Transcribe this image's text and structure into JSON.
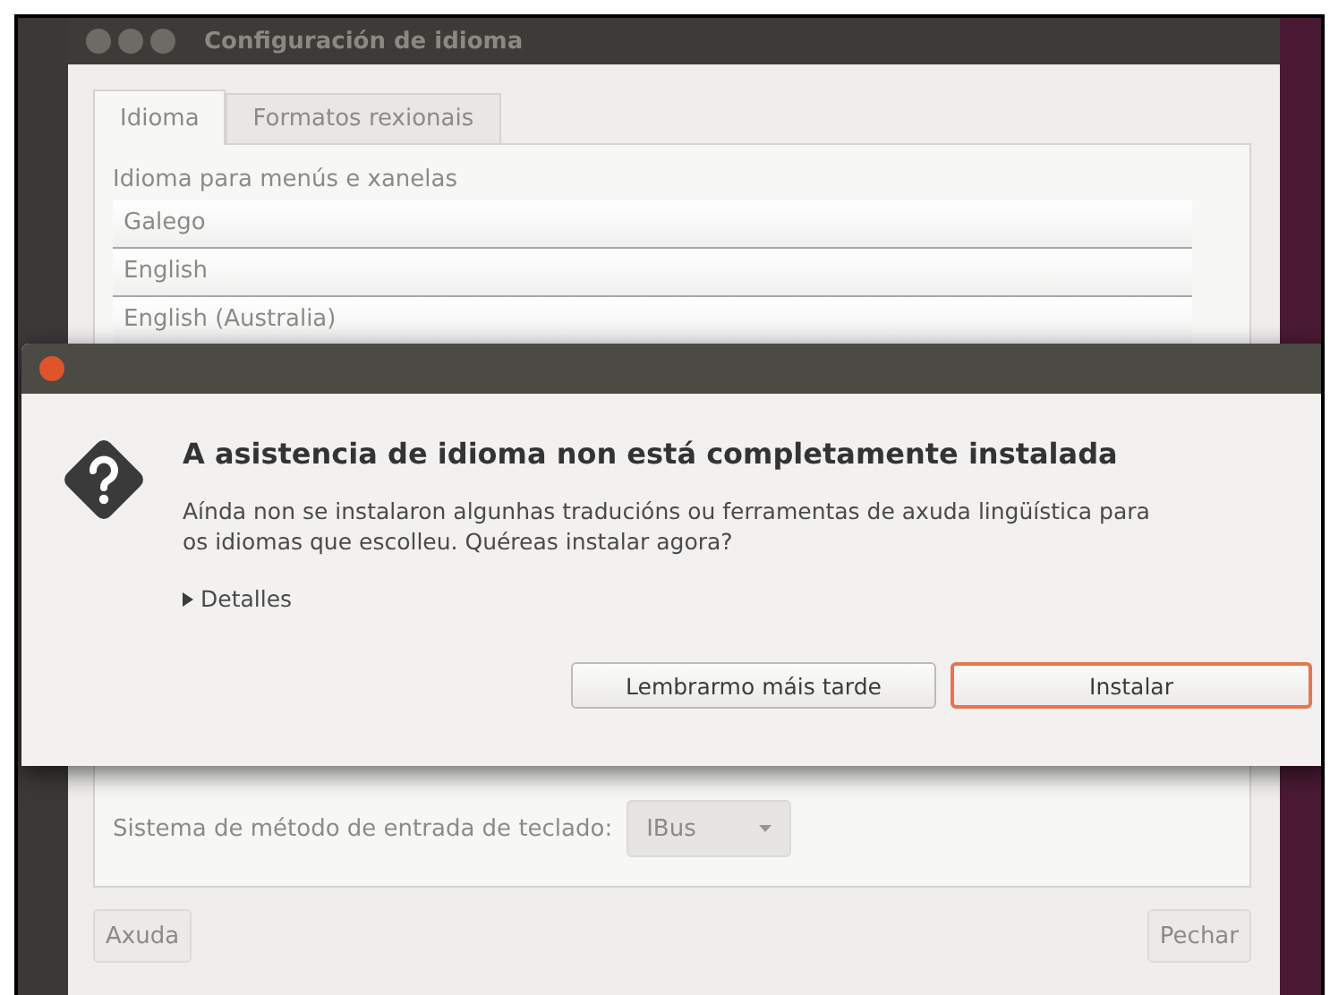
{
  "back_window": {
    "title": "Configuración de idioma",
    "tabs": [
      {
        "label": "Idioma",
        "selected": true
      },
      {
        "label": "Formatos rexionais",
        "selected": false
      }
    ],
    "languages_label": "Idioma para menús e xanelas",
    "languages": [
      "Galego",
      "English",
      "English (Australia)"
    ],
    "input_method_label": "Sistema de método de entrada de teclado:",
    "input_method": "IBus",
    "buttons": [
      {
        "label": "Axuda"
      },
      {
        "label": "Pechar"
      }
    ]
  },
  "dialog": {
    "heading": "A asistencia de idioma non está completamente instalada",
    "message": "Aínda non se instalaron algunhas traducións ou ferramentas de axuda lingüística para os idiomas que escolleu. Quéreas instalar agora?",
    "details": "Detalles",
    "buttons": [
      {
        "label": "Lembrarmo máis tarde",
        "default": false
      },
      {
        "label": "Instalar",
        "default": true
      }
    ]
  }
}
